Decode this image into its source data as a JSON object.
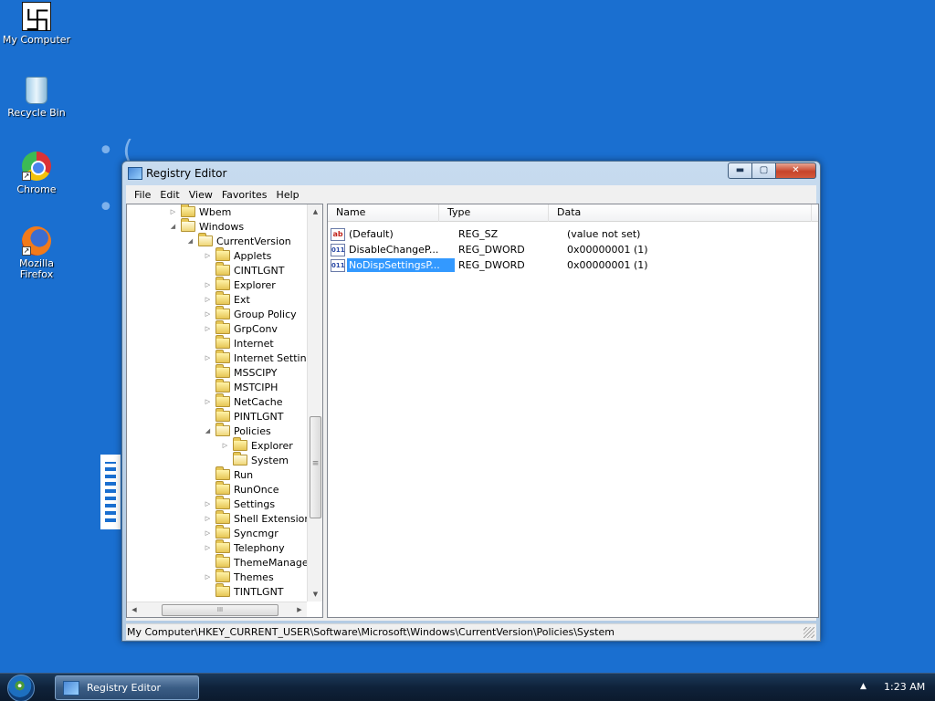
{
  "desktop": {
    "icons": [
      {
        "label": "My Computer",
        "icon": "my-computer-icon"
      },
      {
        "label": "Recycle Bin",
        "icon": "recycle-bin-icon"
      },
      {
        "label": "Chrome",
        "icon": "chrome-icon"
      },
      {
        "label": "Mozilla Firefox",
        "icon": "firefox-icon"
      }
    ]
  },
  "window": {
    "title": "Registry Editor",
    "buttons": {
      "minimize": "▬",
      "maximize": "▢",
      "close": "✕"
    },
    "menu": [
      "File",
      "Edit",
      "View",
      "Favorites",
      "Help"
    ],
    "tree": [
      {
        "label": "Wbem",
        "depth": 0,
        "expander": "▷",
        "open": false
      },
      {
        "label": "Windows",
        "depth": 0,
        "expander": "◢",
        "open": true
      },
      {
        "label": "CurrentVersion",
        "depth": 1,
        "expander": "◢",
        "open": true
      },
      {
        "label": "Applets",
        "depth": 2,
        "expander": "▷",
        "open": false
      },
      {
        "label": "CINTLGNT",
        "depth": 2,
        "expander": "",
        "open": false
      },
      {
        "label": "Explorer",
        "depth": 2,
        "expander": "▷",
        "open": false
      },
      {
        "label": "Ext",
        "depth": 2,
        "expander": "▷",
        "open": false
      },
      {
        "label": "Group Policy",
        "depth": 2,
        "expander": "▷",
        "open": false
      },
      {
        "label": "GrpConv",
        "depth": 2,
        "expander": "▷",
        "open": false
      },
      {
        "label": "Internet",
        "depth": 2,
        "expander": "",
        "open": false
      },
      {
        "label": "Internet Settings",
        "depth": 2,
        "expander": "▷",
        "open": false
      },
      {
        "label": "MSSCIPY",
        "depth": 2,
        "expander": "",
        "open": false
      },
      {
        "label": "MSTCIPH",
        "depth": 2,
        "expander": "",
        "open": false
      },
      {
        "label": "NetCache",
        "depth": 2,
        "expander": "▷",
        "open": false
      },
      {
        "label": "PINTLGNT",
        "depth": 2,
        "expander": "",
        "open": false
      },
      {
        "label": "Policies",
        "depth": 2,
        "expander": "◢",
        "open": true
      },
      {
        "label": "Explorer",
        "depth": 3,
        "expander": "▷",
        "open": false
      },
      {
        "label": "System",
        "depth": 3,
        "expander": "",
        "open": true
      },
      {
        "label": "Run",
        "depth": 2,
        "expander": "",
        "open": false
      },
      {
        "label": "RunOnce",
        "depth": 2,
        "expander": "",
        "open": false
      },
      {
        "label": "Settings",
        "depth": 2,
        "expander": "▷",
        "open": false
      },
      {
        "label": "Shell Extensions",
        "depth": 2,
        "expander": "▷",
        "open": false
      },
      {
        "label": "Syncmgr",
        "depth": 2,
        "expander": "▷",
        "open": false
      },
      {
        "label": "Telephony",
        "depth": 2,
        "expander": "▷",
        "open": false
      },
      {
        "label": "ThemeManager",
        "depth": 2,
        "expander": "",
        "open": false
      },
      {
        "label": "Themes",
        "depth": 2,
        "expander": "▷",
        "open": false
      },
      {
        "label": "TINTLGNT",
        "depth": 2,
        "expander": "",
        "open": false
      }
    ],
    "scroll": {
      "up": "▲",
      "down": "▼",
      "left": "◀",
      "right": "▶",
      "grip_v": "≡",
      "grip_h": "III"
    },
    "list": {
      "columns": [
        "Name",
        "Type",
        "Data"
      ],
      "rows": [
        {
          "name": "(Default)",
          "type": "REG_SZ",
          "data": "(value not set)",
          "icon": "ab",
          "selected": false
        },
        {
          "name": "DisableChangeP...",
          "type": "REG_DWORD",
          "data": "0x00000001 (1)",
          "icon": "011",
          "selected": false
        },
        {
          "name": "NoDispSettingsP...",
          "type": "REG_DWORD",
          "data": "0x00000001 (1)",
          "icon": "011",
          "selected": true
        }
      ]
    },
    "status": "My Computer\\HKEY_CURRENT_USER\\Software\\Microsoft\\Windows\\CurrentVersion\\Policies\\System"
  },
  "taskbar": {
    "task_label": "Registry Editor",
    "tray_arrow": "▲",
    "clock": "1:23 AM"
  }
}
